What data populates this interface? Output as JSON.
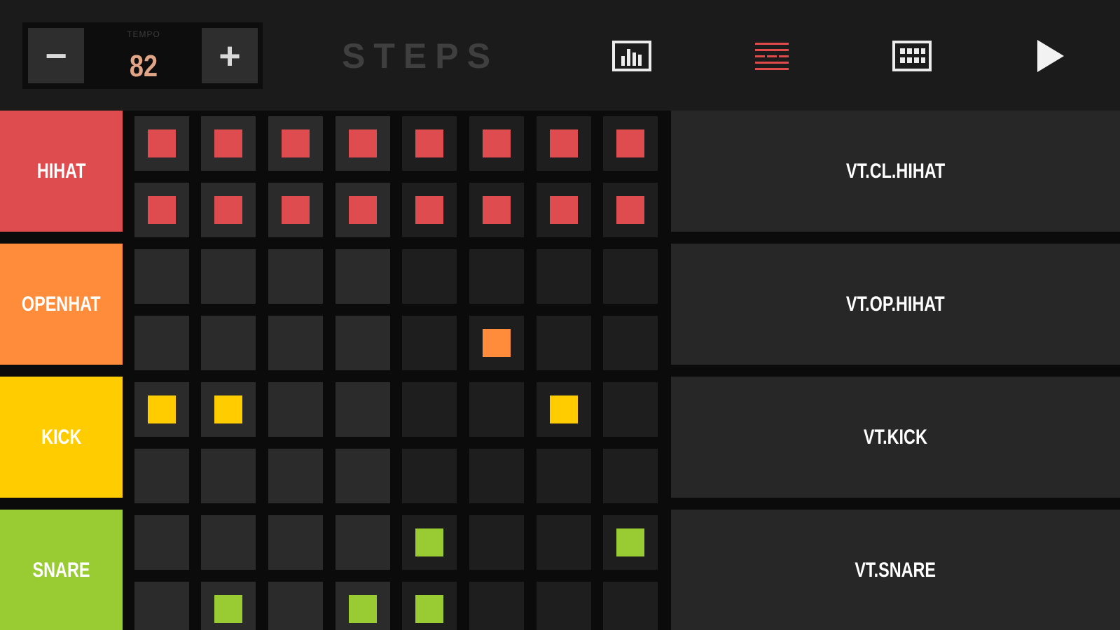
{
  "app": {
    "title": "STEPS"
  },
  "tempo": {
    "label": "TEMPO",
    "value": "82",
    "decrement_label": "−",
    "increment_label": "+"
  },
  "toolbar": {
    "icons": [
      "mixer-bars-icon",
      "step-sequencer-icon",
      "pad-grid-icon",
      "play-icon"
    ],
    "active": "step-sequencer-icon",
    "accent_color": "#e04a4a"
  },
  "colors": {
    "step_group_a": "#2b2b2b",
    "step_group_b": "#1e1e1e",
    "sample_panel": "#272727"
  },
  "tracks": [
    {
      "name": "HIHAT",
      "sample": "VT.CL.HIHAT",
      "color": "#de4c4f",
      "steps": [
        1,
        1,
        1,
        1,
        1,
        1,
        1,
        1,
        1,
        1,
        1,
        1,
        1,
        1,
        1,
        1
      ]
    },
    {
      "name": "OPENHAT",
      "sample": "VT.OP.HIHAT",
      "color": "#ff8c3a",
      "steps": [
        0,
        0,
        0,
        0,
        0,
        0,
        0,
        0,
        0,
        0,
        0,
        0,
        0,
        1,
        0,
        0
      ]
    },
    {
      "name": "KICK",
      "sample": "VT.KICK",
      "color": "#ffcc00",
      "steps": [
        1,
        1,
        0,
        0,
        0,
        0,
        1,
        0,
        0,
        0,
        0,
        0,
        0,
        0,
        0,
        0
      ]
    },
    {
      "name": "SNARE",
      "sample": "VT.SNARE",
      "color": "#99cc33",
      "steps": [
        0,
        0,
        0,
        0,
        1,
        0,
        0,
        1,
        0,
        1,
        0,
        1,
        1,
        0,
        0,
        0
      ]
    }
  ]
}
